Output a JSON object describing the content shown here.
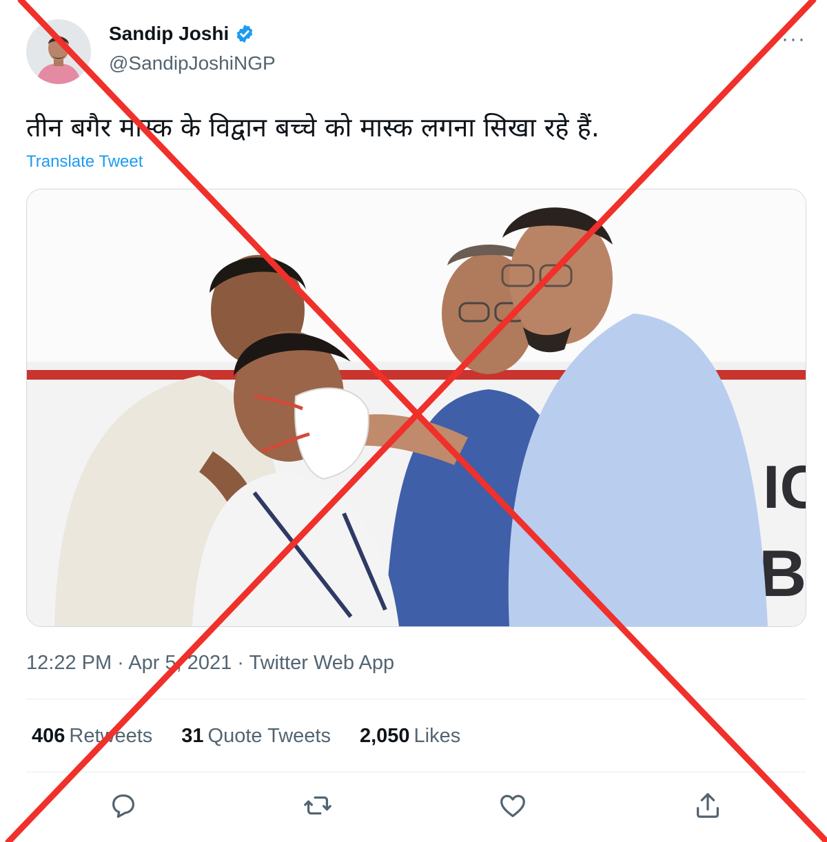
{
  "tweet": {
    "author_name": "Sandip Joshi",
    "handle": "@SandipJoshiNGP",
    "text": "तीन बगैर मास्क के विद्वान बच्चे को मास्क लगना सिखा रहे हैं.",
    "translate_label": "Translate Tweet",
    "timestamp": "12:22 PM · Apr 5, 2021 · Twitter Web App",
    "more_label": "···"
  },
  "stats": {
    "retweets_count": "406",
    "retweets_label": "Retweets",
    "quotes_count": "31",
    "quotes_label": "Quote Tweets",
    "likes_count": "2,050",
    "likes_label": "Likes"
  },
  "media": {
    "sign_text_1": "IC",
    "sign_text_2": "B"
  },
  "icons": [
    "verified-badge-icon",
    "more-icon",
    "reply-icon",
    "retweet-icon",
    "like-icon",
    "share-icon"
  ],
  "colors": {
    "link": "#1d9bf0",
    "verified": "#1d9bf0",
    "muted_text": "#536471",
    "overlay_cross": "#f0302a"
  }
}
